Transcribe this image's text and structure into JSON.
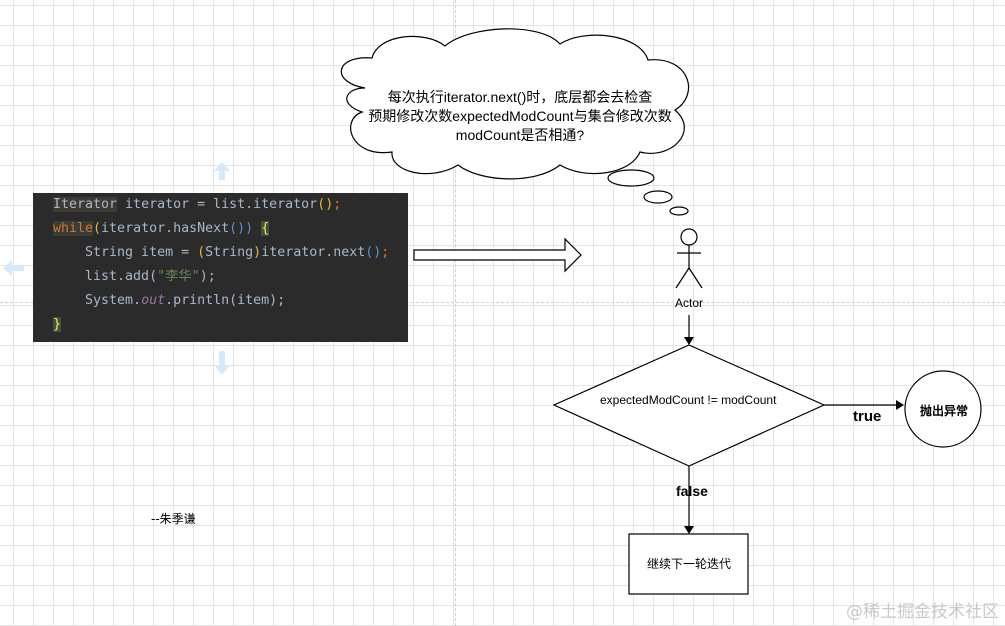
{
  "code": {
    "lines": [
      "Iterator iterator = list.iterator();",
      "while(iterator.hasNext()) {",
      "    String item = (String)iterator.next();",
      "    list.add(\"李华\");",
      "    System.out.println(item);",
      "}"
    ],
    "l1": {
      "type": "Iterator",
      "rest": " iterator = list.iterator",
      "paren": "()",
      "semi": ";"
    },
    "l2": {
      "kw": "while",
      "p1": "(",
      "mid": "iterator.hasNext",
      "p2": "())",
      "sp": " ",
      "brace": "{"
    },
    "l3": {
      "pre": "    String item = ",
      "p1": "(",
      "cast": "String",
      "p2": ")",
      "mid": "iterator.next",
      "p3": "()",
      "semi": ";"
    },
    "l4": {
      "pre": "    list.add(",
      "str": "\"李华\"",
      "post": ");"
    },
    "l5": {
      "pre": "    System.",
      "out": "out",
      "post": ".println(item);"
    },
    "l6": {
      "brace": "}"
    }
  },
  "cloud": {
    "line1": "每次执行iterator.next()时，底层都会去检查",
    "line2": "预期修改次数expectedModCount与集合修改次数",
    "line3": "modCount是否相通?"
  },
  "actor_label": "Actor",
  "decision_label": "expectedModCount != modCount",
  "true_label": "true",
  "false_label": "false",
  "exception_label": "抛出异常",
  "next_label": "继续下一轮迭代",
  "signature": "--朱季谦",
  "watermark": "@稀土掘金技术社区",
  "colors": {
    "code_bg": "#2b2b2b",
    "keyword": "#cc7832",
    "string": "#6a8759",
    "field": "#9876aa",
    "select_arrow": "#d6e9f8"
  }
}
